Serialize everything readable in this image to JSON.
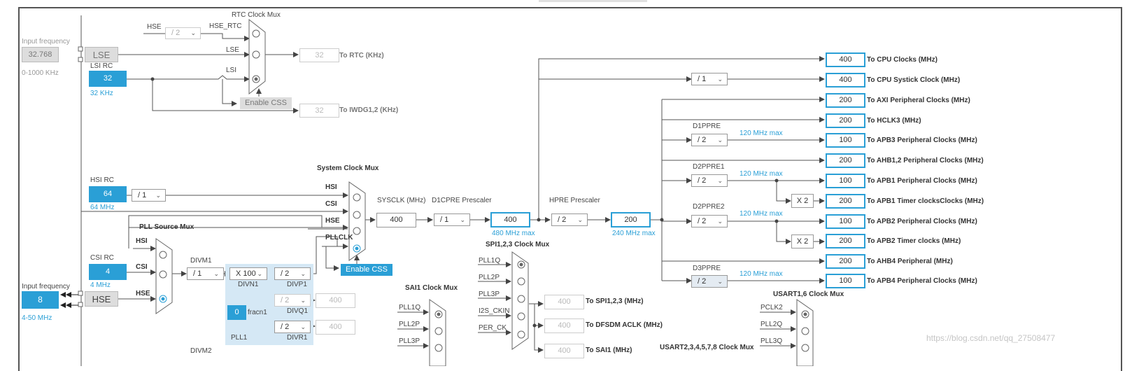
{
  "rtc": {
    "title": "RTC Clock Mux",
    "hse_label": "HSE",
    "hse_div": "/ 2",
    "hse_rtc_label": "HSE_RTC",
    "lse_label": "LSE",
    "lsi_label": "LSI",
    "out_value": "32",
    "out_label": "To RTC (KHz)",
    "enable_css": "Enable CSS",
    "iwdg_value": "32",
    "iwdg_label": "To IWDG1,2 (KHz)"
  },
  "lse": {
    "input_title": "Input frequency",
    "input_value": "32.768",
    "range": "0-1000 KHz",
    "button": "LSE"
  },
  "lsi": {
    "label": "LSI RC",
    "value": "32",
    "unit": "32 KHz"
  },
  "hsi": {
    "label": "HSI RC",
    "value": "64",
    "unit": "64 MHz",
    "div": "/ 1"
  },
  "csi": {
    "label": "CSI RC",
    "value": "4",
    "unit": "4 MHz"
  },
  "hse": {
    "input_title": "Input frequency",
    "value": "8",
    "range": "4-50 MHz",
    "button": "HSE"
  },
  "pll_src": {
    "title": "PLL Source Mux",
    "inputs": [
      "HSI",
      "CSI",
      "HSE"
    ]
  },
  "pll": {
    "divm1_label": "DIVM1",
    "divm1": "/ 1",
    "divn1": "X 100",
    "divn1_label": "DIVN1",
    "divp1": "/ 2",
    "divp1_label": "DIVP1",
    "divq1": "/ 2",
    "divq1_label": "DIVQ1",
    "divq1_out": "400",
    "divr1": "/ 2",
    "divr1_label": "DIVR1",
    "divr1_out": "400",
    "fracn1": "0",
    "fracn1_label": "fracn1",
    "name": "PLL1",
    "divm2_label": "DIVM2"
  },
  "sysmux": {
    "title": "System Clock Mux",
    "inputs": [
      "HSI",
      "CSI",
      "HSE",
      "PLLCLK"
    ],
    "enable_css": "Enable CSS"
  },
  "sysclk": {
    "label": "SYSCLK (MHz)",
    "value": "400"
  },
  "d1cpre": {
    "label": "D1CPRE Prescaler",
    "div": "/ 1",
    "value": "400",
    "max": "480 MHz max"
  },
  "hpre": {
    "label": "HPRE Prescaler",
    "div": "/ 2",
    "value": "200",
    "max": "240 MHz max"
  },
  "cpu_systick_div": "/ 1",
  "d1ppre": {
    "label": "D1PPRE",
    "div": "/ 2",
    "max": "120 MHz max"
  },
  "d2ppre1": {
    "label": "D2PPRE1",
    "div": "/ 2",
    "max": "120 MHz max",
    "mult": "X 2"
  },
  "d2ppre2": {
    "label": "D2PPRE2",
    "div": "/ 2",
    "max": "120 MHz max",
    "mult": "X 2"
  },
  "d3ppre": {
    "label": "D3PPRE",
    "div": "/ 2",
    "max": "120 MHz max"
  },
  "outputs": [
    {
      "value": "400",
      "label": "To CPU Clocks (MHz)"
    },
    {
      "value": "400",
      "label": "To CPU Systick Clock (MHz)"
    },
    {
      "value": "200",
      "label": "To AXI Peripheral Clocks (MHz)"
    },
    {
      "value": "200",
      "label": "To HCLK3 (MHz)"
    },
    {
      "value": "100",
      "label": "To APB3 Peripheral Clocks (MHz)"
    },
    {
      "value": "200",
      "label": "To AHB1,2 Peripheral Clocks (MHz)"
    },
    {
      "value": "100",
      "label": "To APB1 Peripheral Clocks (MHz)"
    },
    {
      "value": "200",
      "label": "To APB1 Timer clocksClocks (MHz)"
    },
    {
      "value": "100",
      "label": "To APB2 Peripheral Clocks (MHz)"
    },
    {
      "value": "200",
      "label": "To APB2 Timer clocks (MHz)"
    },
    {
      "value": "200",
      "label": "To AHB4 Peripheral (MHz)"
    },
    {
      "value": "100",
      "label": "To APB4 Peripheral Clocks (MHz)"
    }
  ],
  "spi123": {
    "title": "SPI1,2,3 Clock Mux",
    "inputs": [
      "PLL1Q",
      "PLL2P",
      "PLL3P",
      "I2S_CKIN",
      "PER_CK"
    ],
    "spi_value": "400",
    "spi_label": "To SPI1,2,3 (MHz)",
    "dfsdm_value": "400",
    "dfsdm_label": "To DFSDM ACLK (MHz)",
    "sai1_value": "400",
    "sai1_label": "To SAI1 (MHz)"
  },
  "sai1": {
    "title": "SAI1 Clock Mux",
    "inputs": [
      "PLL1Q",
      "PLL2P",
      "PLL3P"
    ]
  },
  "usart16": {
    "title": "USART1,6 Clock Mux",
    "inputs": [
      "PCLK2",
      "PLL2Q",
      "PLL3Q"
    ]
  },
  "usart2": {
    "title": "USART2,3,4,5,7,8 Clock Mux"
  },
  "watermark": "https://blog.csdn.net/qq_27508477"
}
